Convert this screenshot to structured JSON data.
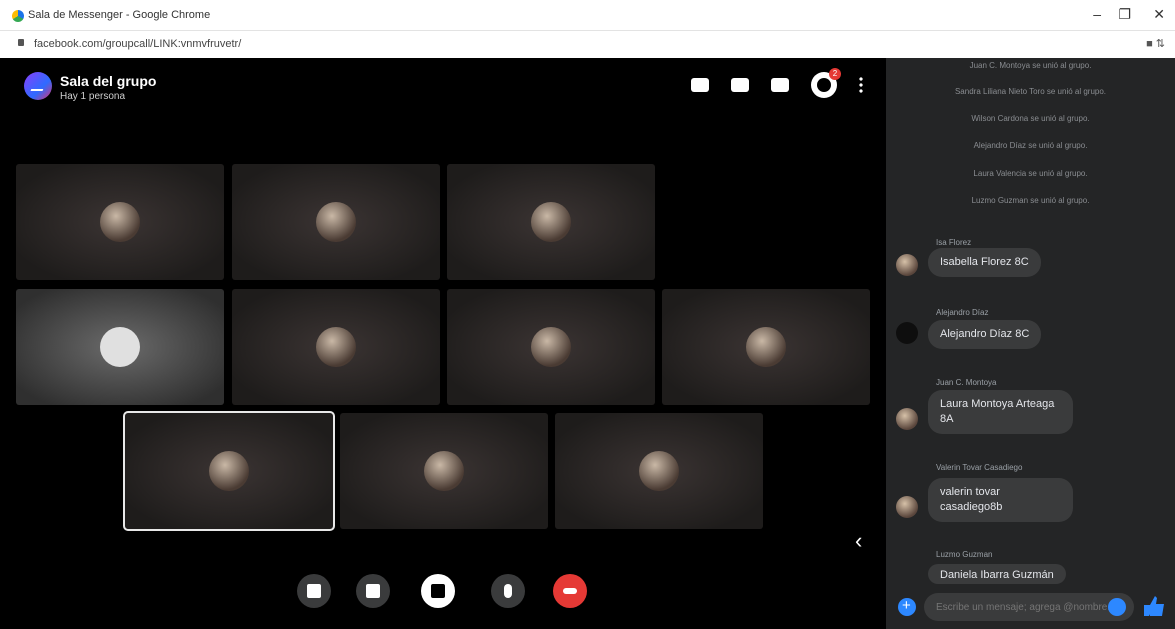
{
  "browser": {
    "tab_title": "Sala de Messenger - Google Chrome",
    "url": "facebook.com/groupcall/LINK:vnmvfruvetr/",
    "minimize": "–",
    "restore": "❐",
    "close": "✕"
  },
  "room": {
    "title": "Sala del grupo",
    "subtitle": "Hay 1 persona",
    "notifications": "2"
  },
  "participants": [
    {
      "name": "participant-1"
    },
    {
      "name": "participant-2"
    },
    {
      "name": "participant-3"
    },
    {
      "name": "participant-4"
    },
    {
      "name": "participant-5"
    },
    {
      "name": "participant-6"
    },
    {
      "name": "participant-7"
    },
    {
      "name": "participant-8"
    },
    {
      "name": "participant-9"
    },
    {
      "name": "participant-10"
    }
  ],
  "chat": {
    "system_messages": [
      "Juan C. Montoya se unió al grupo.",
      "Sandra Liliana Nieto Toro se unió al grupo.",
      "Wilson Cardona se unió al grupo.",
      "Alejandro Díaz se unió al grupo.",
      "Laura Valencia se unió al grupo.",
      "Luzmo Guzman se unió al grupo."
    ],
    "messages": [
      {
        "sender": "Isa Florez",
        "text": "Isabella Florez 8C"
      },
      {
        "sender": "Alejandro Díaz",
        "text": "Alejandro Díaz 8C"
      },
      {
        "sender": "Juan C. Montoya",
        "text": "Laura Montoya Arteaga 8A"
      },
      {
        "sender": "Valerin Tovar Casadiego",
        "text": "valerin tovar casadiego8b"
      },
      {
        "sender": "Luzmo Guzman",
        "text": "Daniela Ibarra Guzmán"
      }
    ],
    "input_placeholder": "Escribe un mensaje; agrega @nombre..."
  },
  "colors": {
    "accent": "#2d88ff",
    "end_call": "#e53935",
    "panel_bg": "#242526"
  }
}
